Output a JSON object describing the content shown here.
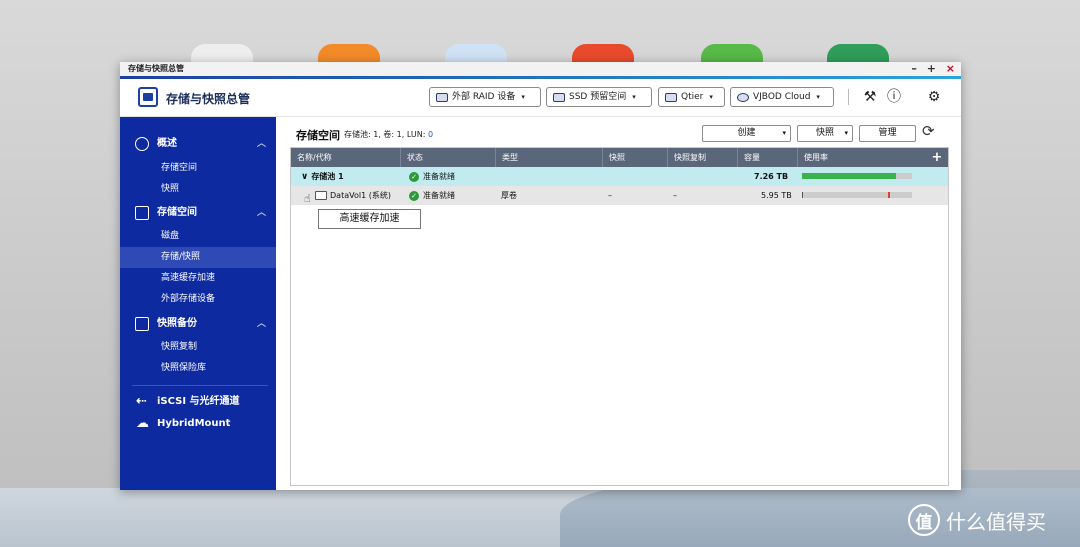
{
  "colors": {
    "sidebar": "#0e2aa0",
    "accent": "#1b3fa3",
    "header_row": "#5a6679",
    "usage_bar": "#37b24d",
    "status_ok": "#2c9a3c",
    "watermark": "#ffffff"
  },
  "window": {
    "titlebar": "存储与快照总管",
    "controls": [
      "–",
      "+",
      "×"
    ]
  },
  "header": {
    "app_title": "存储与快照总管",
    "buttons": [
      {
        "label": "外部 RAID 设备",
        "icon": "raid-icon"
      },
      {
        "label": "SSD 预留空间",
        "icon": "ssd-icon"
      },
      {
        "label": "Qtier",
        "icon": "qtier-icon"
      },
      {
        "label": "VJBOD Cloud",
        "icon": "cloud-icon"
      }
    ],
    "icons": [
      "debug-icon",
      "help-icon",
      "settings-icon"
    ]
  },
  "sidebar": {
    "groups": [
      {
        "label": "概述",
        "icon": "dashboard-icon",
        "items": [
          "存储空间",
          "快照"
        ]
      },
      {
        "label": "存储空间",
        "icon": "storage-icon",
        "items": [
          "磁盘",
          "存储/快照",
          "高速缓存加速",
          "外部存储设备"
        ]
      },
      {
        "label": "快照备份",
        "icon": "snapshot-icon",
        "items": [
          "快照复制",
          "快照保险库"
        ]
      }
    ],
    "active_item": "存储/快照",
    "extras": [
      {
        "label": "iSCSI 与光纤通道",
        "icon": "iscsi-icon"
      },
      {
        "label": "HybridMount",
        "icon": "cloud-mount-icon"
      }
    ]
  },
  "content": {
    "title": "存储空间",
    "summary_prefix": "存储池: ",
    "summary_pools": "1",
    "summary_vol_prefix": ", 卷: ",
    "summary_vols": "1",
    "summary_lun_prefix": ", LUN: ",
    "summary_luns": "0",
    "actions": {
      "create": "创建",
      "snapshot": "快照",
      "manage": "管理"
    },
    "columns": [
      "名称/代称",
      "状态",
      "类型",
      "快照",
      "快照复制",
      "容量",
      "使用率"
    ],
    "rows": [
      {
        "name": "存储池 1",
        "status": "准备就绪",
        "type": "",
        "snapshot": "",
        "replica": "",
        "capacity": "7.26 TB",
        "usage": 0.85
      },
      {
        "name": "DataVol1 (系统)",
        "status": "准备就绪",
        "type": "厚卷",
        "snapshot": "–",
        "replica": "–",
        "capacity": "5.95 TB",
        "usage": 0.01,
        "marker": 0.78
      }
    ],
    "tooltip": "高速缓存加速"
  },
  "watermark": "什么值得买",
  "page_dots": 3
}
